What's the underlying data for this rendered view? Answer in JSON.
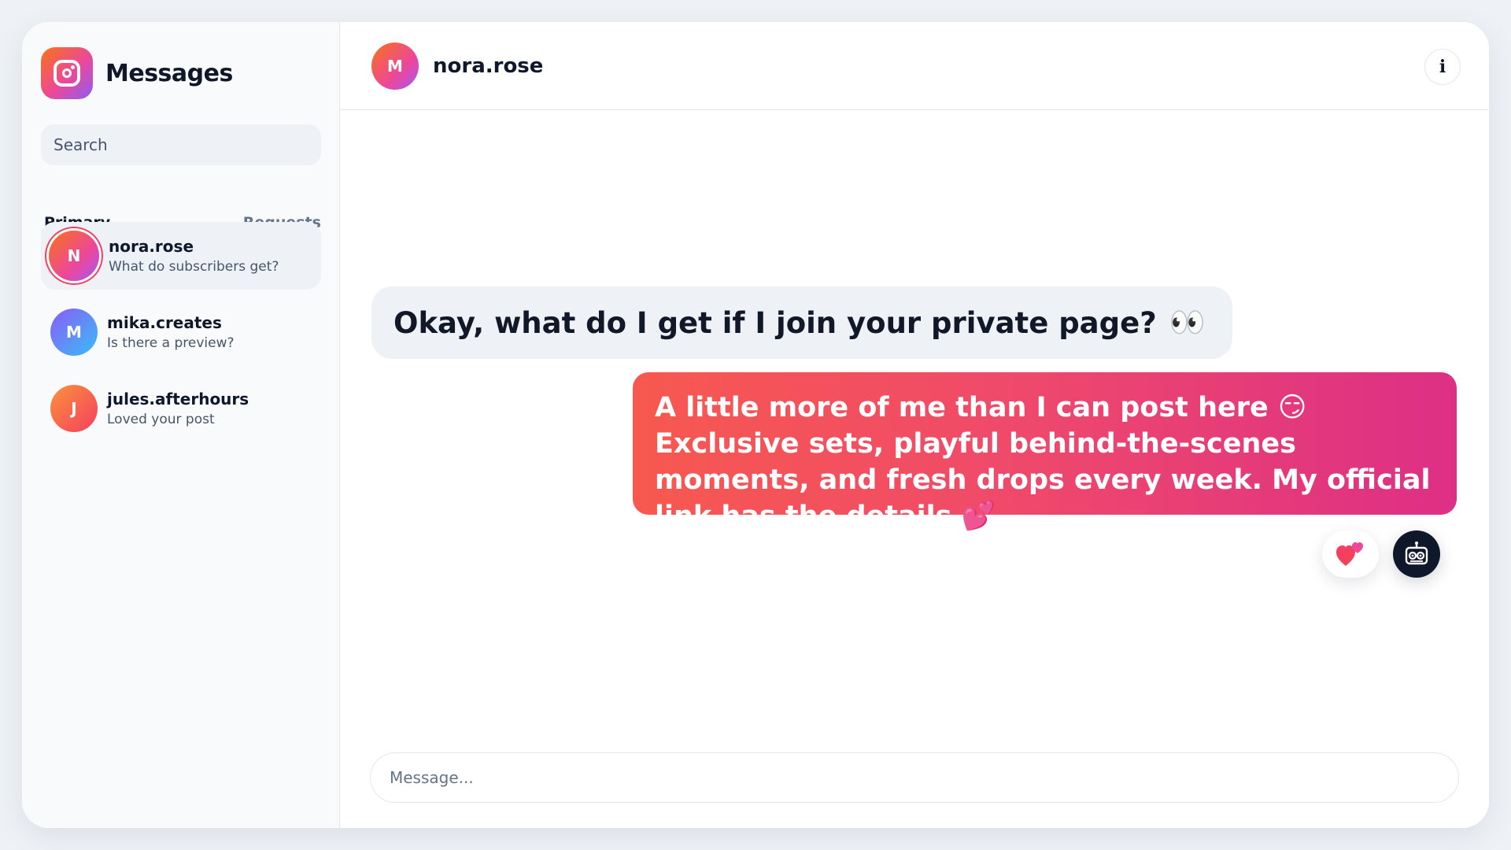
{
  "app": {
    "title": "Messages"
  },
  "search": {
    "placeholder": "Search"
  },
  "tabs": {
    "primary": "Primary",
    "requests": "Requests"
  },
  "conversations": [
    {
      "initial": "N",
      "name": "nora.rose",
      "preview": "What do subscribers get?",
      "active": true
    },
    {
      "initial": "M",
      "name": "mika.creates",
      "preview": "Is there a preview?",
      "active": false
    },
    {
      "initial": "J",
      "name": "jules.afterhours",
      "preview": "Loved your post",
      "active": false
    }
  ],
  "chat": {
    "initial": "M",
    "name": "nora.rose",
    "info_label": "i",
    "messages": [
      {
        "direction": "incoming",
        "text": "Okay, what do I get if I join your private page?",
        "emoji": "👀"
      },
      {
        "direction": "outgoing",
        "text": "A little more of me than I can post here 😏 Exclusive sets, playful behind-the-scenes moments, and fresh drops every week. My official link has the details 💕"
      }
    ],
    "composer_placeholder": "Message..."
  },
  "icons": {
    "brand": "instagram-icon",
    "info": "info-icon",
    "reaction": "two-hearts-icon",
    "assistant": "robot-icon"
  },
  "colors": {
    "brand_gradient_start": "#f97316",
    "brand_gradient_mid": "#ec4899",
    "brand_gradient_end": "#8b5cf6",
    "outgoing_bubble_start": "#f7594f",
    "outgoing_bubble_end": "#dd2f86",
    "incoming_bubble": "#eef1f6"
  }
}
